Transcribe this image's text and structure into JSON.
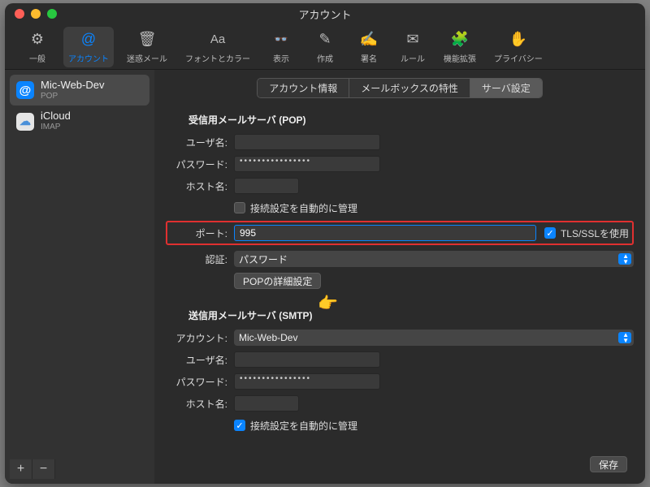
{
  "window": {
    "title": "アカウント"
  },
  "toolbar": {
    "items": [
      {
        "label": "一般"
      },
      {
        "label": "アカウント"
      },
      {
        "label": "迷惑メール"
      },
      {
        "label": "フォントとカラー"
      },
      {
        "label": "表示"
      },
      {
        "label": "作成"
      },
      {
        "label": "署名"
      },
      {
        "label": "ルール"
      },
      {
        "label": "機能拡張"
      },
      {
        "label": "プライバシー"
      }
    ]
  },
  "sidebar": {
    "accounts": [
      {
        "name": "Mic-Web-Dev",
        "type": "POP"
      },
      {
        "name": "iCloud",
        "type": "IMAP"
      }
    ]
  },
  "tabs": {
    "items": [
      {
        "label": "アカウント情報"
      },
      {
        "label": "メールボックスの特性"
      },
      {
        "label": "サーバ設定"
      }
    ]
  },
  "incoming": {
    "title": "受信用メールサーバ (POP)",
    "user_label": "ユーザ名:",
    "user_value": "",
    "password_label": "パスワード:",
    "password_value": "••••••••••••••••",
    "host_label": "ホスト名:",
    "host_value": "",
    "auto_manage_label": "接続設定を自動的に管理",
    "auto_manage_checked": false,
    "port_label": "ポート:",
    "port_value": "995",
    "tls_label": "TLS/SSLを使用",
    "tls_checked": true,
    "auth_label": "認証:",
    "auth_value": "パスワード",
    "advanced_button": "POPの詳細設定"
  },
  "outgoing": {
    "title": "送信用メールサーバ (SMTP)",
    "account_label": "アカウント:",
    "account_value": "Mic-Web-Dev",
    "user_label": "ユーザ名:",
    "user_value": "",
    "password_label": "パスワード:",
    "password_value": "••••••••••••••••",
    "host_label": "ホスト名:",
    "host_value": "",
    "auto_manage_label": "接続設定を自動的に管理",
    "auto_manage_checked": true
  },
  "footer": {
    "save_label": "保存"
  },
  "icons": {
    "pointer": "👈"
  }
}
